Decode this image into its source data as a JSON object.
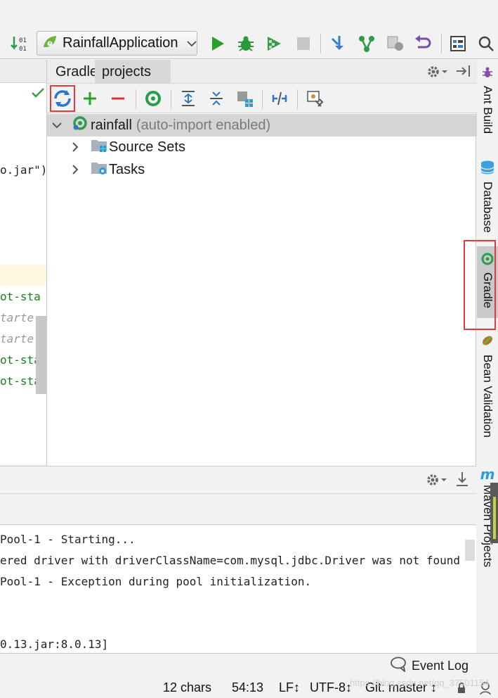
{
  "toolbar": {
    "run_config": "RainfallApplication"
  },
  "editor": {
    "lines": [
      {
        "text": "o.jar\")",
        "style": "dark"
      },
      {
        "text": "ot-sta",
        "style": "green"
      },
      {
        "text": "tarte",
        "style": "gray"
      },
      {
        "text": "tarte",
        "style": "gray"
      },
      {
        "text": "ot-sta",
        "style": "green"
      },
      {
        "text": "ot-sta",
        "style": "green"
      }
    ]
  },
  "gradle": {
    "tabs": [
      "Gradle",
      "projects"
    ],
    "tree": {
      "root": "rainfall",
      "root_note": "(auto-import enabled)",
      "children": [
        "Source Sets",
        "Tasks"
      ]
    }
  },
  "sidebar": {
    "items": [
      "Ant Build",
      "Database",
      "Gradle",
      "Bean Validation",
      "Maven Projects"
    ]
  },
  "console": {
    "lines": [
      "Pool-1 - Starting...",
      "ered driver with driverClassName=com.mysql.jdbc.Driver was not found",
      "Pool-1 - Exception during pool initialization.",
      "0.13.jar:8.0.13]"
    ]
  },
  "event_log": "Event Log",
  "status": {
    "chars": "12 chars",
    "position": "54:13",
    "line_sep": "LF↕",
    "encoding": "UTF-8↕",
    "git": "Git: master ↕"
  },
  "watermark": "https://blog.csdn.net/qq_37501154",
  "colors": {
    "highlight_red": "#e03c3c",
    "run_green": "#2aa02a",
    "gradle_green": "#2a9d4a"
  }
}
